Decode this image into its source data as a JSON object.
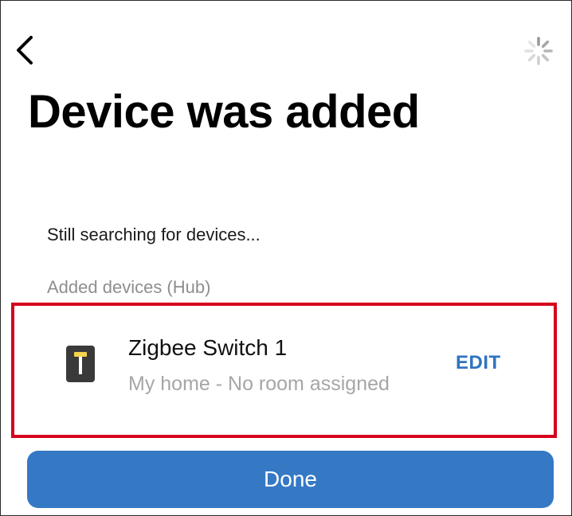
{
  "header": {
    "back_icon": "chevron-left-icon",
    "spinner_icon": "loading-spinner-icon",
    "title": "Device was added"
  },
  "status": {
    "text": "Still searching for devices..."
  },
  "section": {
    "label": "Added devices (Hub)"
  },
  "devices": [
    {
      "name": "Zigbee Switch 1",
      "location": "My home - No room assigned",
      "edit_label": "EDIT",
      "icon": "switch-device-icon"
    }
  ],
  "footer": {
    "done_label": "Done"
  },
  "colors": {
    "accent": "#3579c5",
    "link": "#2f73c0",
    "highlight": "#d6001c",
    "muted": "#8e8e8e",
    "device_icon_body": "#3a3a3a",
    "device_icon_toggle": "#f2d54a"
  }
}
